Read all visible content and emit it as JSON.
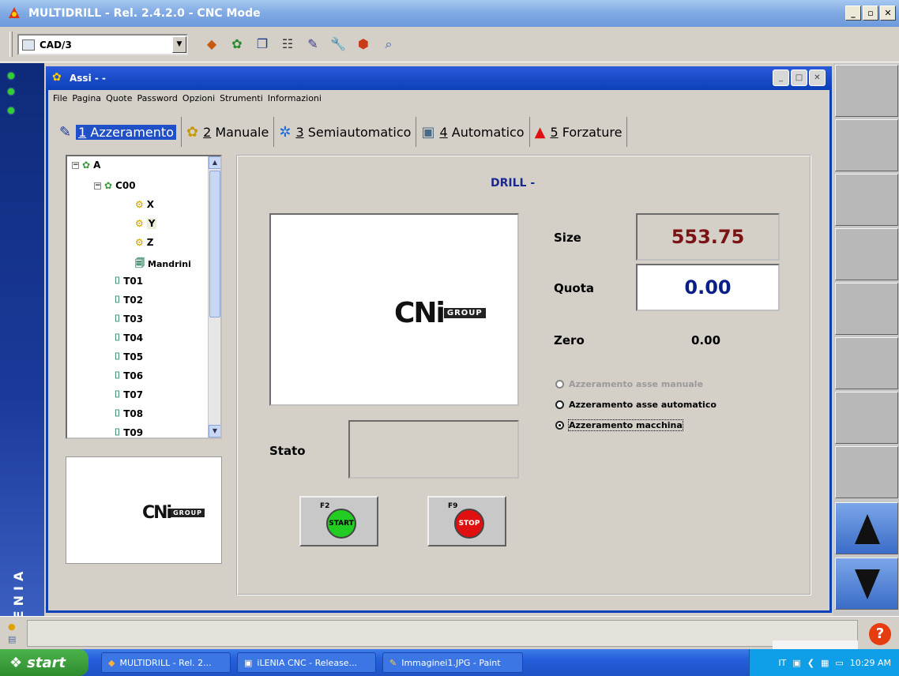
{
  "window": {
    "title": "MULTIDRILL  -  Rel. 2.4.2.0  -  CNC Mode"
  },
  "toolbar": {
    "combo_value": "CAD/3",
    "icons": [
      "globe-icon",
      "gears-icon",
      "window-icon",
      "iso-icon",
      "edit-icon",
      "wrench-icon",
      "export-icon",
      "search-icon"
    ]
  },
  "assi": {
    "title": "Assi - -",
    "menu": [
      "File",
      "Pagina",
      "Quote",
      "Password",
      "Opzioni",
      "Strumenti",
      "Informazioni"
    ],
    "tabs": [
      {
        "num": "1",
        "label": "Azzeramento",
        "icon": "wrench-icon"
      },
      {
        "num": "2",
        "label": "Manuale",
        "icon": "gears-icon"
      },
      {
        "num": "3",
        "label": "Semiautomatico",
        "icon": "gear-arrow-icon"
      },
      {
        "num": "4",
        "label": "Automatico",
        "icon": "computer-gear-icon"
      },
      {
        "num": "5",
        "label": "Forzature",
        "icon": "warning-icon"
      }
    ]
  },
  "tree": {
    "root": "A",
    "group": "C00",
    "axes": [
      "X",
      "Y",
      "Z"
    ],
    "mandrini": "Mandrini",
    "tools": [
      "T01",
      "T02",
      "T03",
      "T04",
      "T05",
      "T06",
      "T07",
      "T08",
      "T09"
    ]
  },
  "logo": {
    "big": "CNi",
    "group": "GROUP"
  },
  "panel": {
    "drill_title": "DRILL -",
    "size_label": "Size",
    "size_value": "553.75",
    "quota_label": "Quota",
    "quota_value": "0.00",
    "zero_label": "Zero",
    "zero_value": "0.00",
    "stato_label": "Stato",
    "radios": [
      "Azzeramento asse manuale",
      "Azzeramento asse automatico",
      "Azzeramento macchina"
    ],
    "start_key": "F2",
    "start_label": "START",
    "stop_key": "F9",
    "stop_label": "STOP"
  },
  "side": {
    "brand": "iLENIA"
  },
  "taskbar": {
    "start": "start",
    "tasks": [
      "MULTIDRILL - Rel. 2...",
      "iLENIA CNC - Release...",
      "Immaginei1.JPG - Paint"
    ],
    "lang": "IT",
    "clock": "10:29 AM"
  },
  "colors": {
    "title_blue": "#0b3fb8",
    "size_red": "#7a1414",
    "quota_blue": "#0a1e8a",
    "start_green": "#22cc22",
    "stop_red": "#e01010"
  }
}
